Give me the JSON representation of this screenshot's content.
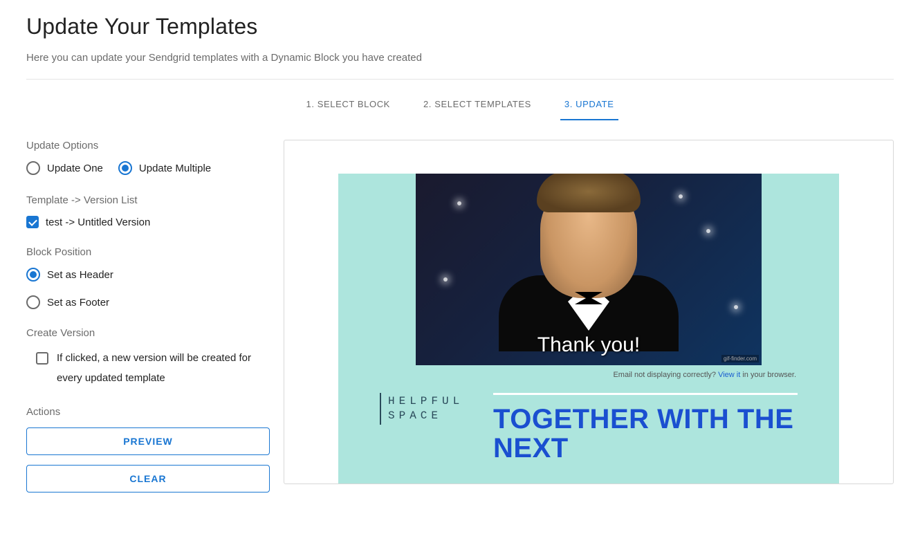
{
  "page": {
    "title": "Update Your Templates",
    "subtitle": "Here you can update your Sendgrid templates with a Dynamic Block you have created"
  },
  "tabs": [
    {
      "label": "1. SELECT BLOCK",
      "active": false
    },
    {
      "label": "2. SELECT TEMPLATES",
      "active": false
    },
    {
      "label": "3. UPDATE",
      "active": true
    }
  ],
  "sidebar": {
    "update_options": {
      "label": "Update Options",
      "one": "Update One",
      "multiple": "Update Multiple",
      "selected": "multiple"
    },
    "version_list": {
      "label": "Template -> Version List",
      "items": [
        {
          "label": "test -> Untitled Version",
          "checked": true
        }
      ]
    },
    "block_position": {
      "label": "Block Position",
      "header": "Set as Header",
      "footer": "Set as Footer",
      "selected": "header"
    },
    "create_version": {
      "label": "Create Version",
      "description": "If clicked, a new version will be created for every updated template",
      "checked": false
    },
    "actions": {
      "label": "Actions",
      "preview": "PREVIEW",
      "clear": "CLEAR"
    }
  },
  "preview": {
    "hero_caption": "Thank you!",
    "watermark": "gif-finder.com",
    "browser_text_pre": "Email not displaying correctly? ",
    "browser_link": "View it",
    "browser_text_post": " in your browser.",
    "logo_line1": "HELPFUL",
    "logo_line2": "SPACE",
    "headline": "TOGETHER WITH THE NEXT"
  }
}
